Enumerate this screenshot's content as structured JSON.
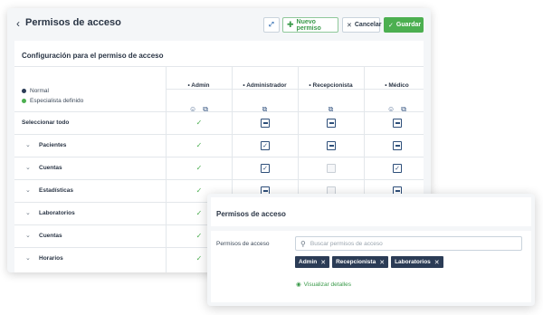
{
  "header": {
    "back_icon": "‹",
    "title": "Permisos de acceso",
    "expand_icon": "⤢",
    "new_label": "Nuevo permiso",
    "cancel_label": "Cancelar",
    "save_label": "Guardar"
  },
  "config": {
    "title": "Configuración para el permiso de acceso",
    "legend": [
      {
        "label": "Normal",
        "color": "#2b3c56"
      },
      {
        "label": "Especialista definido",
        "color": "#4caf50"
      }
    ],
    "columns": [
      {
        "label": "• Admin",
        "icons": [
          "shield-icon",
          "copy-icon"
        ]
      },
      {
        "label": "• Administrador",
        "icons": [
          "copy-icon"
        ]
      },
      {
        "label": "• Recepcionista",
        "icons": [
          "copy-icon"
        ]
      },
      {
        "label": "• Médico",
        "icons": [
          "shield-icon",
          "copy-icon"
        ]
      }
    ],
    "select_all": "Seleccionar todo",
    "rows": [
      {
        "label": "Pacientes"
      },
      {
        "label": "Cuentas"
      },
      {
        "label": "Estadísticas"
      },
      {
        "label": "Laboratorios"
      },
      {
        "label": "Cuentas"
      },
      {
        "label": "Horarios"
      }
    ]
  },
  "overlay": {
    "title": "Permisos de acceso",
    "field_label": "Permisos de acceso",
    "search_placeholder": "Buscar permisos de acceso",
    "tags": [
      "Admin",
      "Recepcionista",
      "Laboratorios"
    ],
    "details_link": "Visualizar detalles"
  },
  "colors": {
    "accent_green": "#4caf50",
    "navy": "#2b3c56"
  }
}
